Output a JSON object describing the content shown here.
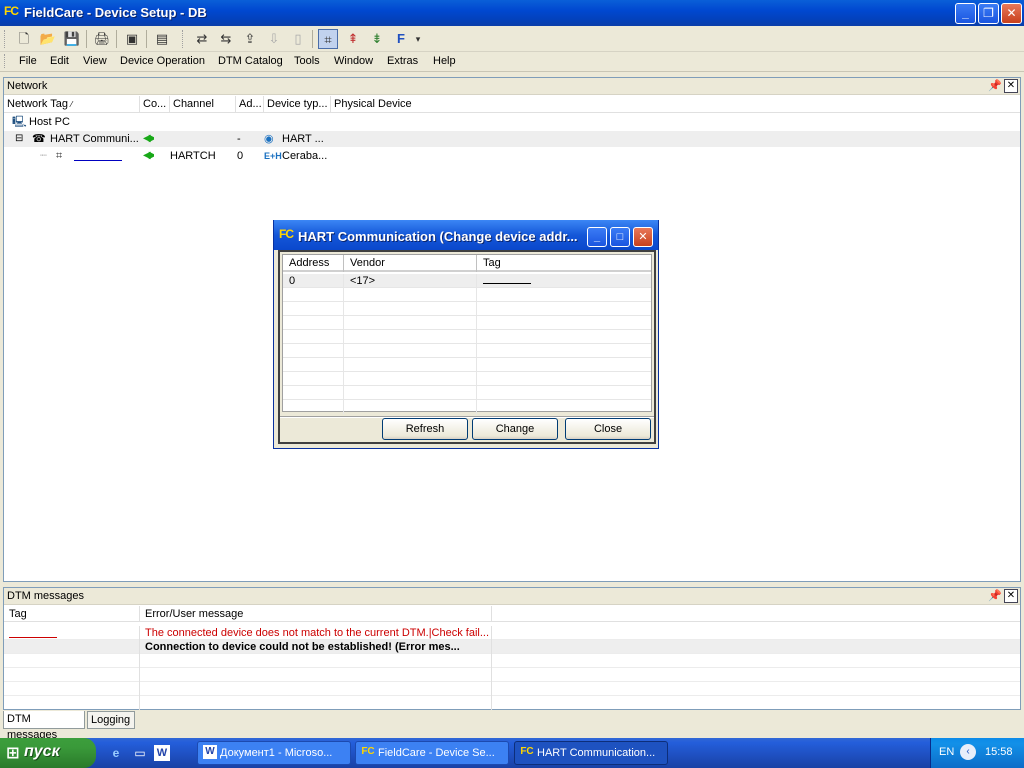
{
  "window": {
    "app_icon": "FC",
    "title": "FieldCare - Device Setup - DB",
    "controls": [
      "minimize-icon",
      "restore-icon",
      "close-icon"
    ]
  },
  "toolbar": {
    "buttons": [
      "new-icon",
      "open-icon",
      "save-icon",
      "print-icon",
      "catalog-icon",
      "device-list-icon",
      "connect-icon",
      "disconnect-icon",
      "upload-icon",
      "download-icon",
      "document-icon",
      "scan-icon",
      "read-icon",
      "write-icon",
      "f-icon",
      "dropdown-icon"
    ],
    "f_label": "F",
    "dropdown_glyph": "▾"
  },
  "menu": {
    "items": [
      "File",
      "Edit",
      "View",
      "Device Operation",
      "DTM Catalog",
      "Tools",
      "Window",
      "Extras",
      "Help"
    ]
  },
  "network": {
    "title": "Network",
    "columns": [
      "Network Tag",
      "Co...",
      "Channel",
      "Ad...",
      "Device typ...",
      "Physical Device"
    ],
    "rows": [
      {
        "tag": "Host PC",
        "co": "",
        "channel": "",
        "address": "",
        "device_type": ""
      },
      {
        "tag": "HART Communi...",
        "co": "◀▶",
        "channel": "",
        "address": "-",
        "device_type": "HART ..."
      },
      {
        "tag": "",
        "co": "◀▶",
        "channel": "HARTCH",
        "address": "0",
        "device_type": "Ceraba..."
      }
    ],
    "tree_expander": "⊟",
    "eh_logo": "E+H"
  },
  "dialog": {
    "icon": "FC",
    "title": "HART Communication  (Change device addr...",
    "columns": [
      "Address",
      "Vendor",
      "Tag"
    ],
    "rows": [
      {
        "address": "0",
        "vendor": "<17>",
        "tag": ""
      }
    ],
    "buttons": {
      "refresh": "Refresh",
      "change": "Change",
      "close": "Close"
    }
  },
  "dtm_messages": {
    "title": "DTM messages",
    "columns": [
      "Tag",
      "Error/User message"
    ],
    "rows": [
      {
        "tag": "",
        "message": "The connected device does not match to the current DTM.|Check fail...",
        "color": "#cc0000"
      },
      {
        "tag": "",
        "message": "Connection to device could not be established! (Error mes...",
        "color": "#000000"
      }
    ],
    "tabs": [
      "DTM messages",
      "Logging"
    ]
  },
  "taskbar": {
    "start_label": "пуск",
    "tasks": [
      {
        "label": "Документ1 - Microso...",
        "icon": "W"
      },
      {
        "label": "FieldCare - Device Se...",
        "icon": "FC"
      },
      {
        "label": "HART Communication...",
        "icon": "FC"
      }
    ],
    "word_icon": "W",
    "language": "EN",
    "clock": "15:58"
  }
}
